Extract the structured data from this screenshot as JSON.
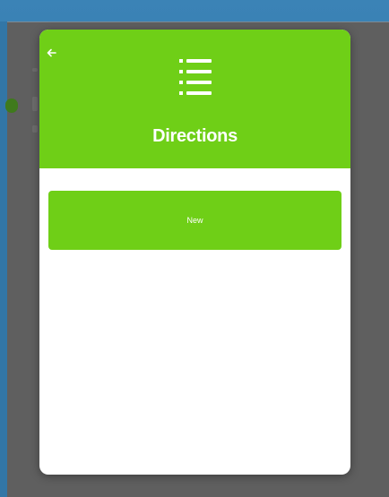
{
  "modal": {
    "title": "Directions",
    "header_icon": "list-icon",
    "back_icon": "arrow-left-icon",
    "new_button_label": "New"
  },
  "colors": {
    "accent": "#6fcf17",
    "overlay": "#5f5f5f",
    "window_frame": "#2f6f9c",
    "modal_background": "#ffffff"
  }
}
